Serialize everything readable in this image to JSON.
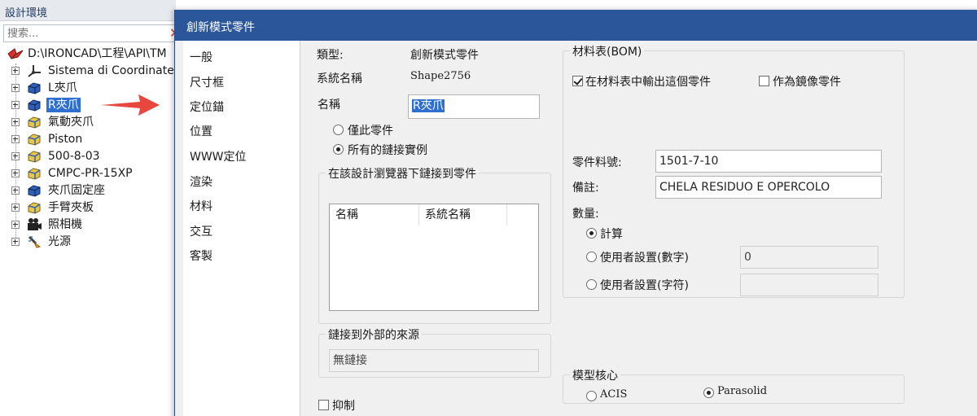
{
  "left_panel": {
    "title": "設計環境",
    "search": {
      "placeholder": "搜索..."
    },
    "tree": {
      "root": "D:\\IRONCAD\\工程\\API\\TM",
      "items": [
        {
          "label": "Sistema di Coordinate",
          "icon": "coordinate-system-icon"
        },
        {
          "label": "L夾爪",
          "icon": "blue-part-icon"
        },
        {
          "label": "R夾爪",
          "icon": "blue-part-icon",
          "selected": true
        },
        {
          "label": "氣動夾爪",
          "icon": "yellow-part-icon"
        },
        {
          "label": "Piston",
          "icon": "yellow-part-icon"
        },
        {
          "label": "500-8-03",
          "icon": "yellow-part-icon"
        },
        {
          "label": "CMPC-PR-15XP",
          "icon": "yellow-part-icon"
        },
        {
          "label": "夾爪固定座",
          "icon": "blue-part-icon"
        },
        {
          "label": "手臂夾板",
          "icon": "yellow-part-icon"
        },
        {
          "label": "照相機",
          "icon": "camera-icon"
        },
        {
          "label": "光源",
          "icon": "light-icon"
        }
      ]
    }
  },
  "dialog": {
    "title": "創新模式零件",
    "nav": [
      "一般",
      "尺寸框",
      "定位錨",
      "位置",
      "WWW定位",
      "渲染",
      "材料",
      "交互",
      "客製"
    ],
    "general": {
      "type_label": "類型:",
      "type_value": "創新模式零件",
      "sys_name_label": "系統名稱",
      "sys_name_value": "Shape2756",
      "name_label": "名稱",
      "name_value": "R夾爪",
      "radio_this_part": "僅此零件",
      "radio_all_instances": "所有的鏈接實例",
      "links_group_title": "在該設計瀏覽器下鏈接到零件",
      "links_columns": [
        "名稱",
        "系統名稱"
      ],
      "external_group_title": "鏈接到外部的來源",
      "external_value": "無鏈接",
      "suppress_label": "抑制"
    },
    "bom": {
      "group_title": "材料表(BOM)",
      "output_in_bom": "在材料表中輸出這個零件",
      "as_mirror": "作為鏡像零件",
      "part_number_label": "零件料號:",
      "part_number_value": "1501-7-10",
      "remark_label": "備註:",
      "remark_value": "CHELA RESIDUO E OPERCOLO",
      "quantity_label": "數量:",
      "qty_calc": "計算",
      "qty_user_number": "使用者設置(數字)",
      "qty_user_number_value": "0",
      "qty_user_text": "使用者設置(字符)",
      "qty_user_text_value": ""
    },
    "kernel": {
      "group_title": "模型核心",
      "acis": "ACIS",
      "parasolid": "Parasolid"
    }
  },
  "colors": {
    "titlebar": "#2b579a",
    "selection": "#2f6fd1",
    "arrow": "#e8473d"
  }
}
